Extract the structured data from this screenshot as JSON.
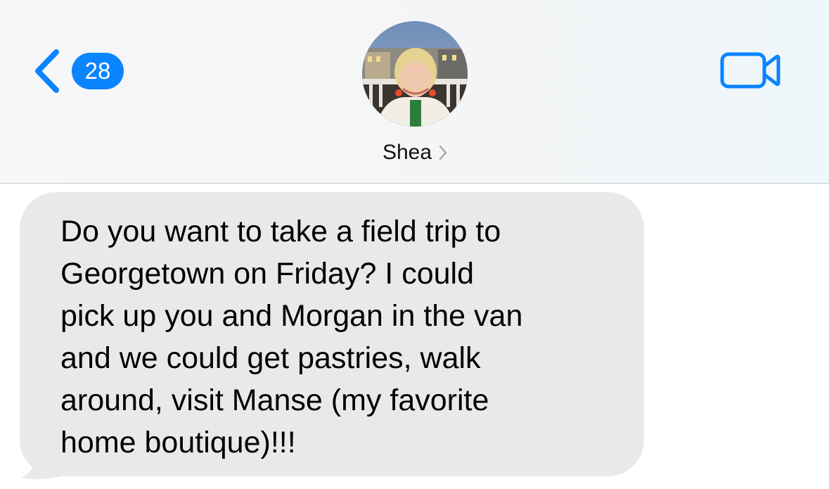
{
  "header": {
    "back": {
      "unread_count": "28",
      "icon": "chevron-left-icon"
    },
    "contact": {
      "name": "Shea",
      "avatar": "contact-photo",
      "chevron_icon": "chevron-right-icon"
    },
    "video_call": {
      "icon": "video-camera-icon"
    }
  },
  "conversation": {
    "messages": [
      {
        "direction": "incoming",
        "text": "Do you want to take a field trip to\nGeorgetown on Friday? I could\npick up you and Morgan in the van\nand we could get pastries, walk\naround, visit Manse (my favorite\nhome boutique)!!!"
      }
    ]
  },
  "colors": {
    "accent": "#0a84ff",
    "incoming_bubble": "#e9e9eb",
    "header_background": "#f6f6f7"
  }
}
